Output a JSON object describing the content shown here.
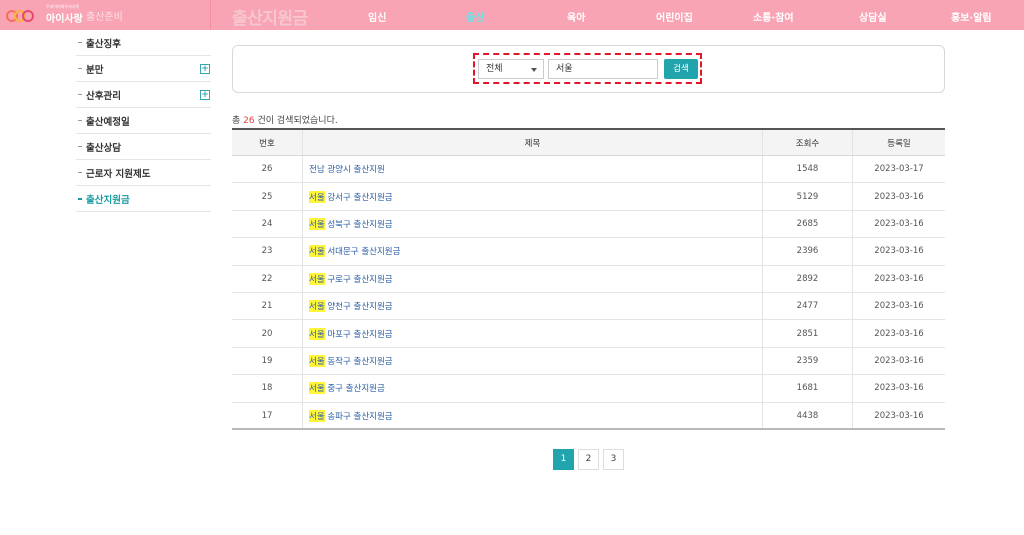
{
  "header": {
    "logo": {
      "tagline": "우리아이와우리가족",
      "name": "아이사랑",
      "colors": [
        "#f36f5a",
        "#f7b33c",
        "#e84a6f"
      ]
    },
    "breadcrumb": "출산준비",
    "page_title": "출산지원금",
    "nav": [
      {
        "label": "임신",
        "active": false
      },
      {
        "label": "출산",
        "active": true
      },
      {
        "label": "육아",
        "active": false
      },
      {
        "label": "어린이집",
        "active": false
      },
      {
        "label": "소통·참여",
        "active": false
      },
      {
        "label": "상담실",
        "active": false
      },
      {
        "label": "홍보·알림",
        "active": false
      }
    ],
    "bar_color": "#f9a4b4",
    "active_color": "#6ee0e6"
  },
  "sidebar": {
    "items": [
      {
        "label": "출산징후",
        "expandable": false,
        "active": false
      },
      {
        "label": "분만",
        "expandable": true,
        "active": false
      },
      {
        "label": "산후관리",
        "expandable": true,
        "active": false
      },
      {
        "label": "출산예정일",
        "expandable": false,
        "active": false
      },
      {
        "label": "출산상담",
        "expandable": false,
        "active": false
      },
      {
        "label": "근로자 지원제도",
        "expandable": false,
        "active": false
      },
      {
        "label": "출산지원금",
        "expandable": false,
        "active": true
      }
    ],
    "expand_symbol": "+"
  },
  "search": {
    "category_value": "전체",
    "keyword_value": "서울",
    "button_label": "검색"
  },
  "results": {
    "prefix": "총 ",
    "count": "26",
    "suffix": " 건이 검색되었습니다."
  },
  "table": {
    "headers": {
      "no": "번호",
      "title": "제목",
      "views": "조회수",
      "date": "등록일"
    },
    "rows": [
      {
        "no": "26",
        "highlight": "",
        "title": "전남 광양시 출산지원",
        "views": "1548",
        "date": "2023-03-17"
      },
      {
        "no": "25",
        "highlight": "서울",
        "title": " 강서구 출산지원금",
        "views": "5129",
        "date": "2023-03-16"
      },
      {
        "no": "24",
        "highlight": "서울",
        "title": " 성북구 출산지원금",
        "views": "2685",
        "date": "2023-03-16"
      },
      {
        "no": "23",
        "highlight": "서울",
        "title": " 서대문구 출산지원금",
        "views": "2396",
        "date": "2023-03-16"
      },
      {
        "no": "22",
        "highlight": "서울",
        "title": " 구로구 출산지원금",
        "views": "2892",
        "date": "2023-03-16"
      },
      {
        "no": "21",
        "highlight": "서울",
        "title": " 양천구 출산지원금",
        "views": "2477",
        "date": "2023-03-16"
      },
      {
        "no": "20",
        "highlight": "서울",
        "title": " 마포구 출산지원금",
        "views": "2851",
        "date": "2023-03-16"
      },
      {
        "no": "19",
        "highlight": "서울",
        "title": " 동작구 출산지원금",
        "views": "2359",
        "date": "2023-03-16"
      },
      {
        "no": "18",
        "highlight": "서울",
        "title": " 중구 출산지원금",
        "views": "1681",
        "date": "2023-03-16"
      },
      {
        "no": "17",
        "highlight": "서울",
        "title": " 송파구 출산지원금",
        "views": "4438",
        "date": "2023-03-16"
      }
    ]
  },
  "pagination": {
    "pages": [
      "1",
      "2",
      "3"
    ],
    "current": "1"
  }
}
